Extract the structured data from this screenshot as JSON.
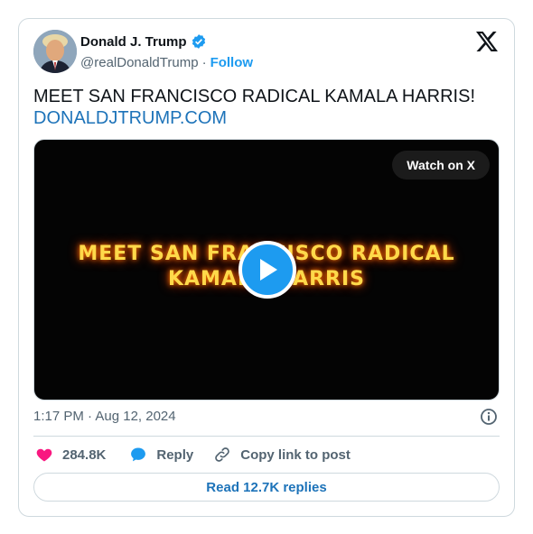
{
  "author": {
    "name": "Donald J. Trump",
    "handle": "@realDonaldTrump",
    "separator": "·",
    "follow_label": "Follow",
    "verified": true
  },
  "tweet": {
    "text": "MEET SAN FRANCISCO RADICAL KAMALA HARRIS!",
    "link": "DONALDJTRUMP.COM"
  },
  "media": {
    "watch_label": "Watch on X",
    "overlay_line1": "MEET SAN FRANCISCO RADICAL",
    "overlay_line2": "KAMALA HARRIS",
    "play_icon": "play-icon"
  },
  "meta": {
    "timestamp": "1:17 PM · Aug 12, 2024"
  },
  "actions": {
    "likes": "284.8K",
    "reply_label": "Reply",
    "copy_label": "Copy link to post"
  },
  "footer": {
    "read_replies": "Read 12.7K replies"
  },
  "colors": {
    "accent": "#1d9bf0",
    "link": "#1d73b9",
    "like": "#f91880",
    "secondary_text": "#536471",
    "border": "#cfd9de"
  }
}
